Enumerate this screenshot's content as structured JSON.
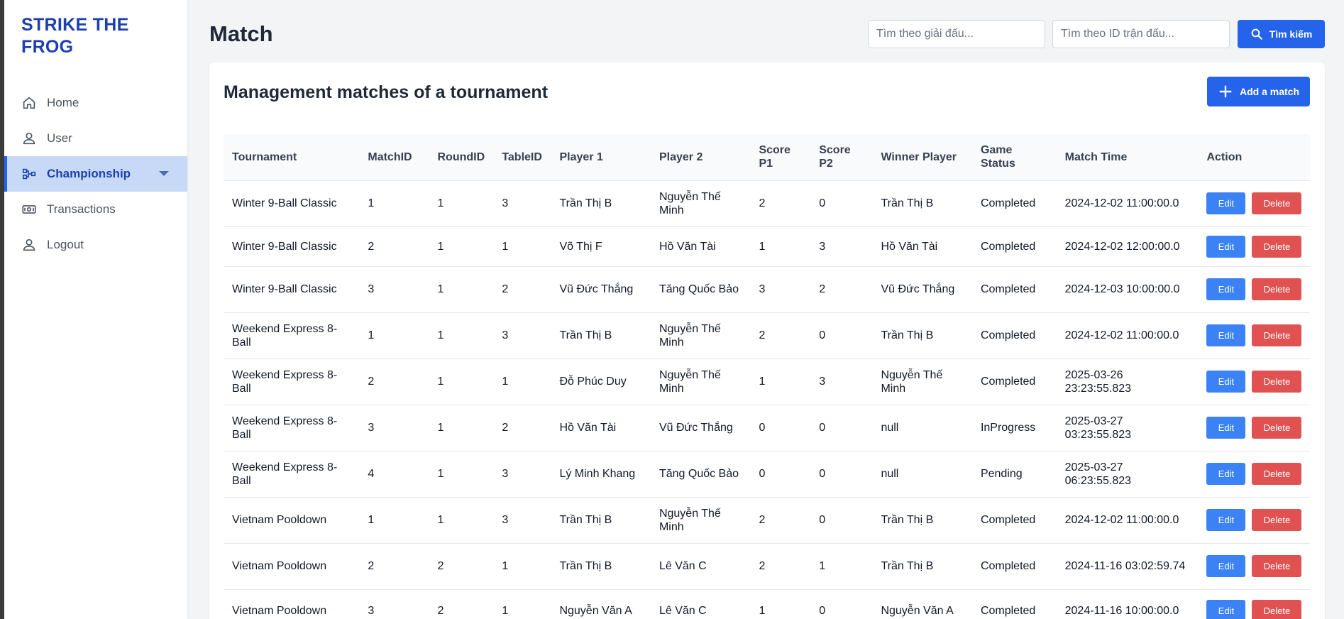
{
  "brand": {
    "name": "STRIKE THE FROG"
  },
  "sidebar": {
    "items": [
      {
        "label": "Home",
        "icon": "home-icon",
        "active": false
      },
      {
        "label": "User",
        "icon": "user-icon",
        "active": false
      },
      {
        "label": "Championship",
        "icon": "tournament-bracket-icon",
        "active": true
      },
      {
        "label": "Transactions",
        "icon": "money-icon",
        "active": false
      },
      {
        "label": "Logout",
        "icon": "user-icon",
        "active": false
      }
    ]
  },
  "header": {
    "title": "Match",
    "search_tournament_placeholder": "Tìm theo giải đấu...",
    "search_match_placeholder": "Tìm theo ID trận đấu...",
    "search_button": "Tìm kiếm"
  },
  "card": {
    "title": "Management matches of a tournament",
    "add_button": "Add a match"
  },
  "table": {
    "columns": [
      "Tournament",
      "MatchID",
      "RoundID",
      "TableID",
      "Player 1",
      "Player 2",
      "Score P1",
      "Score P2",
      "Winner Player",
      "Game Status",
      "Match Time",
      "Action"
    ],
    "rows": [
      [
        "Winter 9-Ball Classic",
        "1",
        "1",
        "3",
        "Trần Thị B",
        "Nguyễn Thế Minh",
        "2",
        "0",
        "Trần Thị B",
        "Completed",
        "2024-12-02 11:00:00.0"
      ],
      [
        "Winter 9-Ball Classic",
        "2",
        "1",
        "1",
        "Võ Thị F",
        "Hồ Văn Tài",
        "1",
        "3",
        "Hồ Văn Tài",
        "Completed",
        "2024-12-02 12:00:00.0"
      ],
      [
        "Winter 9-Ball Classic",
        "3",
        "1",
        "2",
        "Vũ Đức Thắng",
        "Tăng Quốc Bảo",
        "3",
        "2",
        "Vũ Đức Thắng",
        "Completed",
        "2024-12-03 10:00:00.0"
      ],
      [
        "Weekend Express 8-Ball",
        "1",
        "1",
        "3",
        "Trần Thị B",
        "Nguyễn Thế Minh",
        "2",
        "0",
        "Trần Thị B",
        "Completed",
        "2024-12-02 11:00:00.0"
      ],
      [
        "Weekend Express 8-Ball",
        "2",
        "1",
        "1",
        "Đỗ Phúc Duy",
        "Nguyễn Thế Minh",
        "1",
        "3",
        "Nguyễn Thế Minh",
        "Completed",
        "2025-03-26 23:23:55.823"
      ],
      [
        "Weekend Express 8-Ball",
        "3",
        "1",
        "2",
        "Hồ Văn Tài",
        "Vũ Đức Thắng",
        "0",
        "0",
        "null",
        "InProgress",
        "2025-03-27 03:23:55.823"
      ],
      [
        "Weekend Express 8-Ball",
        "4",
        "1",
        "3",
        "Lý Minh Khang",
        "Tăng Quốc Bảo",
        "0",
        "0",
        "null",
        "Pending",
        "2025-03-27 06:23:55.823"
      ],
      [
        "Vietnam Pooldown",
        "1",
        "1",
        "3",
        "Trần Thị B",
        "Nguyễn Thế Minh",
        "2",
        "0",
        "Trần Thị B",
        "Completed",
        "2024-12-02 11:00:00.0"
      ],
      [
        "Vietnam Pooldown",
        "2",
        "2",
        "1",
        "Trần Thị B",
        "Lê Văn C",
        "2",
        "1",
        "Trần Thị B",
        "Completed",
        "2024-11-16 03:02:59.74"
      ],
      [
        "Vietnam Pooldown",
        "3",
        "2",
        "1",
        "Nguyễn Văn A",
        "Lê Văn C",
        "1",
        "0",
        "Nguyễn Văn A",
        "Completed",
        "2024-11-16 10:00:00.0"
      ]
    ],
    "edit_label": "Edit",
    "delete_label": "Delete"
  },
  "colors": {
    "brand": "#1e40af",
    "primary": "#2563eb",
    "edit": "#3b82f6",
    "delete": "#e05252",
    "active_nav_bg": "#c7d9f7"
  }
}
